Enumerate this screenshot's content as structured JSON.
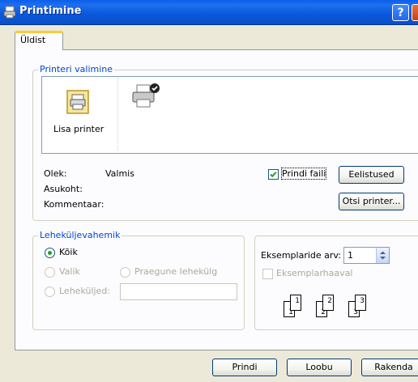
{
  "window": {
    "title": "Printimine",
    "help_label": "?"
  },
  "tabs": [
    {
      "label": "Üldist",
      "active": true
    }
  ],
  "printer_select": {
    "legend": "Printeri valimine",
    "items": [
      {
        "label": "Lisa printer",
        "icon": "add-printer-icon"
      },
      {
        "label": "",
        "icon": "default-printer-icon"
      }
    ],
    "status_label": "Olek:",
    "status_value": "Valmis",
    "location_label": "Asukoht:",
    "location_value": "",
    "comment_label": "Kommentaar:",
    "comment_value": "",
    "print_to_file_label": "Prindi faili",
    "print_to_file_checked": true,
    "preferences_label": "Eelistused",
    "find_printer_label": "Otsi printer..."
  },
  "page_range": {
    "legend": "Leheküljevahemik",
    "all_label": "Kõik",
    "all_selected": true,
    "selection_label": "Valik",
    "current_page_label": "Praegune lehekülg",
    "pages_label": "Leheküljed:",
    "pages_value": ""
  },
  "copies": {
    "count_label": "Eksemplaride arv:",
    "count_value": "1",
    "collate_label": "Eksemplarhaaval",
    "collate_checked": false,
    "collate_pages": [
      "1",
      "1",
      "2",
      "2",
      "3",
      "3"
    ]
  },
  "footer": {
    "print_label": "Prindi",
    "cancel_label": "Loobu",
    "apply_label": "Rakenda"
  },
  "colors": {
    "titlebar": "#0a57d9",
    "dialog_bg": "#ece9d8",
    "group_legend": "#0046d5",
    "tab_highlight": "#ffc83c"
  }
}
